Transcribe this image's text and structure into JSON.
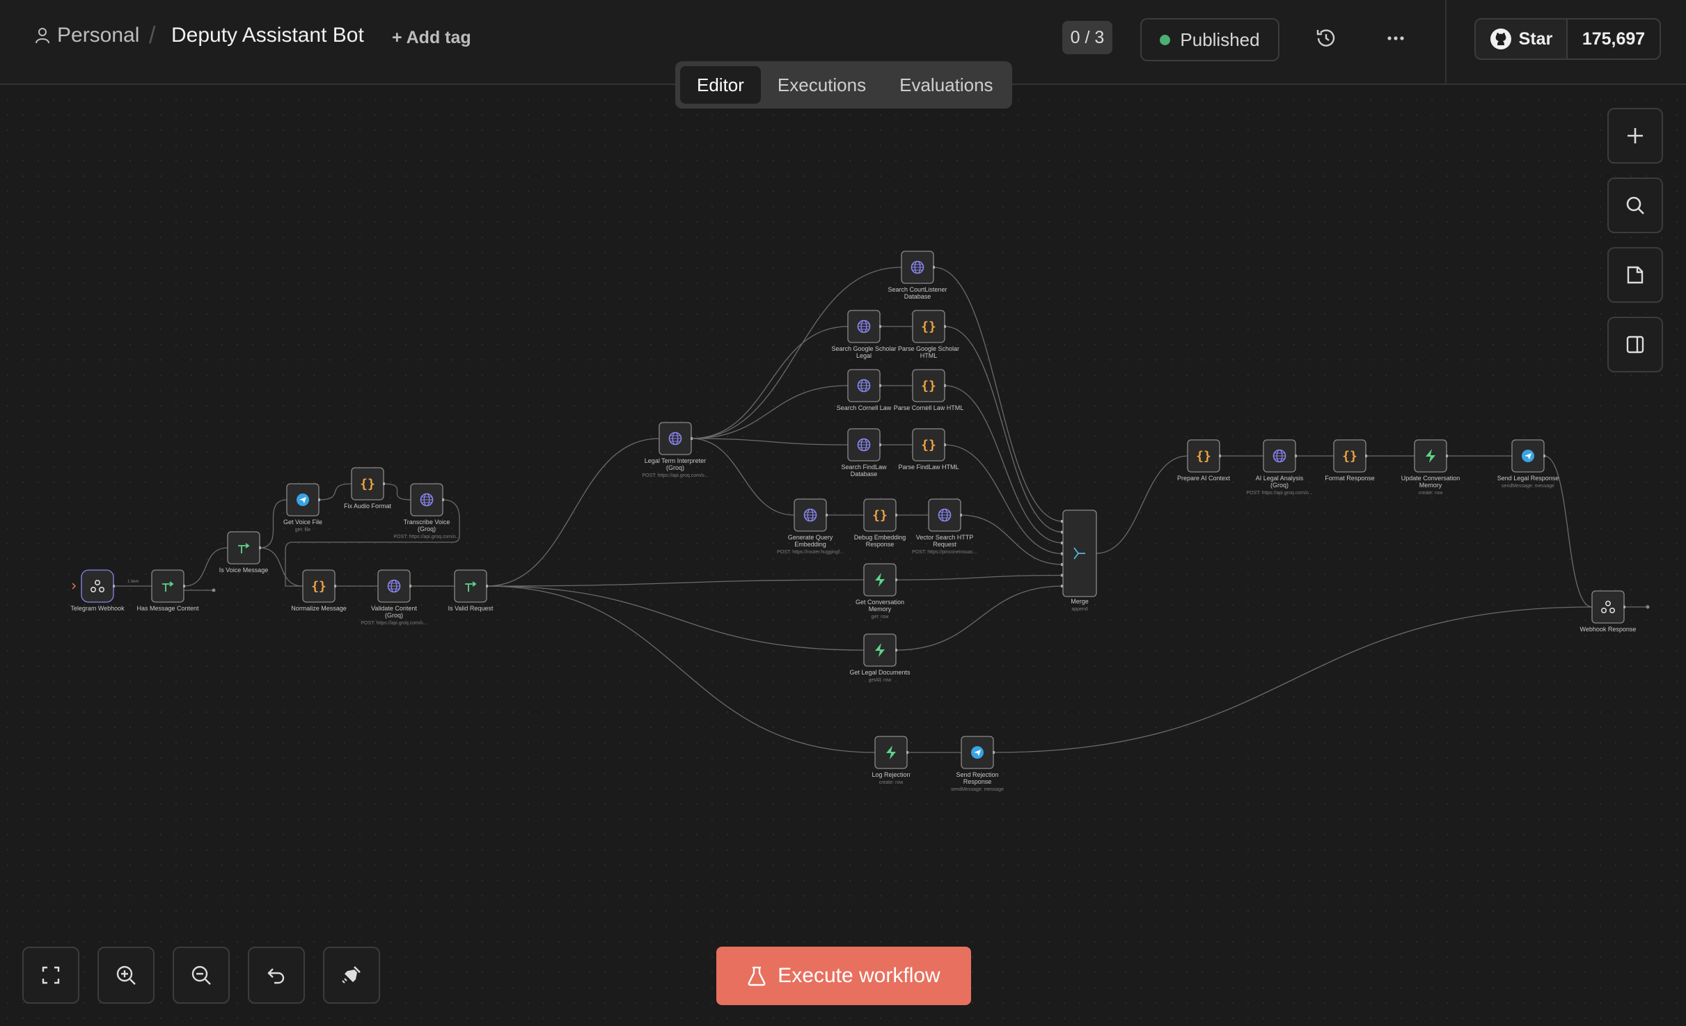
{
  "header": {
    "personal": "Personal",
    "separator": "/",
    "workflow_title": "Deputy Assistant Bot",
    "add_tag": "+ Add tag",
    "counter": "0 / 3",
    "status": "Published",
    "star_label": "Star",
    "star_count": "175,697"
  },
  "tabs": [
    "Editor",
    "Executions",
    "Evaluations"
  ],
  "execute_label": "Execute workflow",
  "colors": {
    "accent": "#e8705f",
    "published_dot": "#4caf73",
    "code_icon": "#f0a543",
    "http_icon": "#8a86f0",
    "db_icon": "#5dd58a",
    "telegram_icon": "#3aa3e3"
  },
  "edge_label": "1 item",
  "nodes": [
    {
      "id": "telegram-webhook",
      "label": "Telegram Webhook",
      "sub": "",
      "icon": "webhook"
    },
    {
      "id": "has-message-content",
      "label": "Has Message Content",
      "sub": "",
      "icon": "if"
    },
    {
      "id": "is-voice-message",
      "label": "Is Voice Message",
      "sub": "",
      "icon": "if"
    },
    {
      "id": "get-voice-file",
      "label": "Get Voice File",
      "sub": "get: file",
      "icon": "telegram"
    },
    {
      "id": "fix-audio-format",
      "label": "Fix Audio Format",
      "sub": "",
      "icon": "code"
    },
    {
      "id": "transcribe-voice",
      "label": "Transcribe Voice (Groq)",
      "sub": "POST: https://api.groq.com/o...",
      "icon": "http"
    },
    {
      "id": "normalize-message",
      "label": "Normalize Message",
      "sub": "",
      "icon": "code"
    },
    {
      "id": "validate-content",
      "label": "Validate Content (Groq)",
      "sub": "POST: https://api.groq.com/o...",
      "icon": "http"
    },
    {
      "id": "is-valid-request",
      "label": "Is Valid Request",
      "sub": "",
      "icon": "if"
    },
    {
      "id": "legal-term-interpreter",
      "label": "Legal Term Interpreter (Groq)",
      "sub": "POST: https://api.groq.com/o...",
      "icon": "http"
    },
    {
      "id": "search-courtlistener",
      "label": "Search CourtListener Database",
      "sub": "",
      "icon": "http"
    },
    {
      "id": "search-google-scholar",
      "label": "Search Google Scholar Legal",
      "sub": "",
      "icon": "http"
    },
    {
      "id": "parse-google-scholar",
      "label": "Parse Google Scholar HTML",
      "sub": "",
      "icon": "code"
    },
    {
      "id": "search-cornell-law",
      "label": "Search Cornell Law",
      "sub": "",
      "icon": "http"
    },
    {
      "id": "parse-cornell-law",
      "label": "Parse Cornell Law HTML",
      "sub": "",
      "icon": "code"
    },
    {
      "id": "search-findlaw",
      "label": "Search FindLaw Database",
      "sub": "",
      "icon": "http"
    },
    {
      "id": "parse-findlaw",
      "label": "Parse FindLaw HTML",
      "sub": "",
      "icon": "code"
    },
    {
      "id": "generate-query-embedding",
      "label": "Generate Query Embedding",
      "sub": "POST: https://router.huggingf...",
      "icon": "http"
    },
    {
      "id": "debug-embedding",
      "label": "Debug Embedding Response",
      "sub": "",
      "icon": "code"
    },
    {
      "id": "vector-search",
      "label": "Vector Search HTTP Request",
      "sub": "POST: https://pinconeinsuac...",
      "icon": "http"
    },
    {
      "id": "get-conversation-memory",
      "label": "Get Conversation Memory",
      "sub": "get: row",
      "icon": "db"
    },
    {
      "id": "get-legal-documents",
      "label": "Get Legal Documents",
      "sub": "getAll: row",
      "icon": "db"
    },
    {
      "id": "merge",
      "label": "Merge",
      "sub": "append",
      "icon": "merge"
    },
    {
      "id": "prepare-ai-context",
      "label": "Prepare AI Context",
      "sub": "",
      "icon": "code"
    },
    {
      "id": "ai-legal-analysis",
      "label": "AI Legal Analysis (Groq)",
      "sub": "POST: https://api.groq.com/o...",
      "icon": "http"
    },
    {
      "id": "format-response",
      "label": "Format Response",
      "sub": "",
      "icon": "code"
    },
    {
      "id": "update-conversation-memory",
      "label": "Update Conversation Memory",
      "sub": "create: row",
      "icon": "db"
    },
    {
      "id": "send-legal-response",
      "label": "Send Legal Response",
      "sub": "sendMessage: message",
      "icon": "telegram"
    },
    {
      "id": "webhook-response",
      "label": "Webhook Response",
      "sub": "",
      "icon": "webhook"
    },
    {
      "id": "log-rejection",
      "label": "Log Rejection",
      "sub": "create: row",
      "icon": "db"
    },
    {
      "id": "send-rejection-response",
      "label": "Send Rejection Response",
      "sub": "sendMessage: message",
      "icon": "telegram"
    }
  ]
}
